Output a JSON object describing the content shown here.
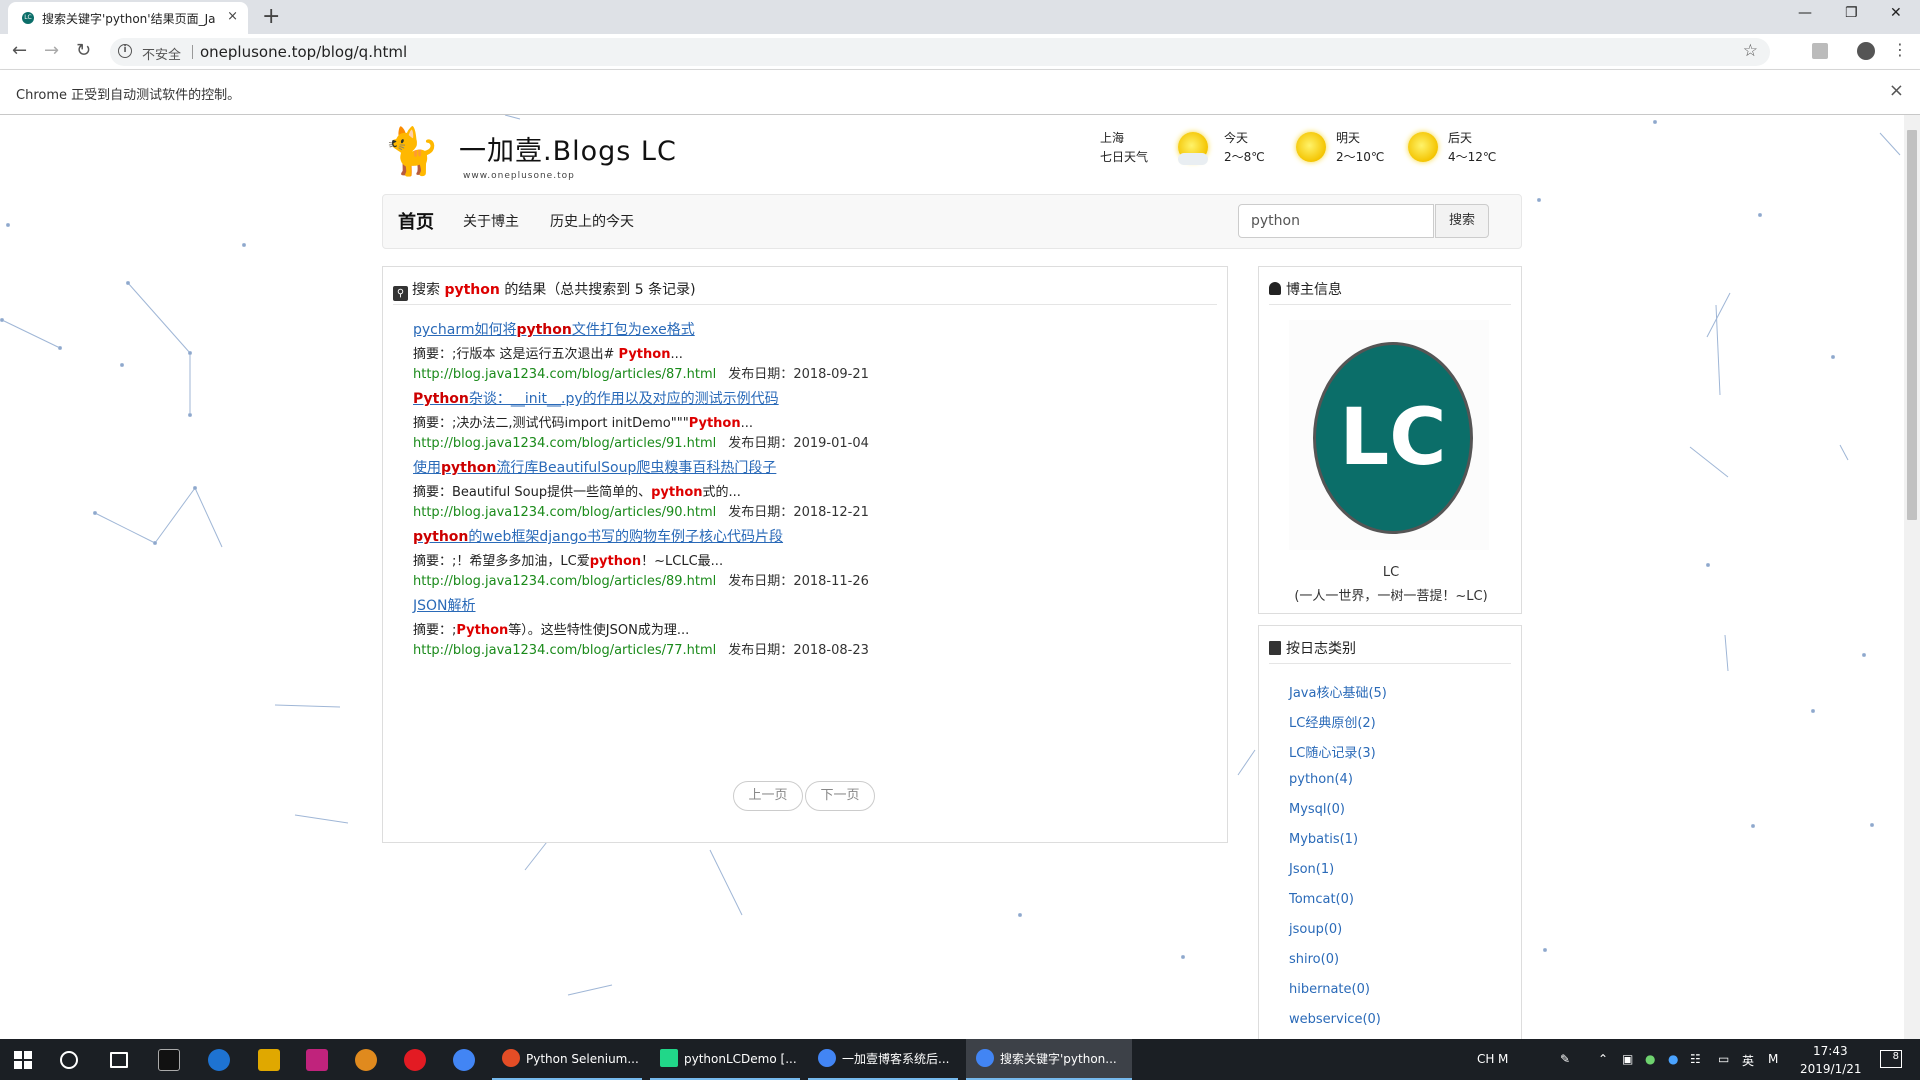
{
  "browser": {
    "tab_title": "搜索关键字'python'结果页面_Ja",
    "tab_close": "×",
    "new_tab": "+",
    "security_label": "不安全",
    "url": "oneplusone.top/blog/q.html",
    "infobar_message": "Chrome 正受到自动测试软件的控制。",
    "infobar_close": "×",
    "favicon_text": "LC"
  },
  "site": {
    "logo_title": "一加壹.Blogs LC",
    "logo_sub": "www.oneplusone.top",
    "weather": {
      "city": "上海",
      "forecast_label": "七日天气",
      "days": [
        {
          "label": "今天",
          "temp": "2～8℃"
        },
        {
          "label": "明天",
          "temp": "2～10℃"
        },
        {
          "label": "后天",
          "temp": "4～12℃"
        }
      ]
    },
    "nav": {
      "home": "首页",
      "about": "关于博主",
      "history": "历史上的今天"
    },
    "search": {
      "value": "python",
      "button": "搜索"
    }
  },
  "results": {
    "head_prefix": "搜索",
    "keyword": "python",
    "head_suffix": "的结果（总共搜索到 5 条记录)",
    "date_label": "发布日期：",
    "items": [
      {
        "title_pre": "pycharm如何将",
        "title_hl": "python",
        "title_post": "文件打包为exe格式",
        "summary_pre": "摘要：;行版本 这是运行五次退出# ",
        "summary_hl": "Python",
        "summary_post": "...",
        "url": "http://blog.java1234.com/blog/articles/87.html",
        "date": "2018-09-21"
      },
      {
        "title_pre": "",
        "title_hl": "Python",
        "title_post": "杂谈：__init__.py的作用以及对应的测试示例代码",
        "summary_pre": "摘要：;决办法二,测试代码import initDemo\"\"\"",
        "summary_hl": "Python",
        "summary_post": "...",
        "url": "http://blog.java1234.com/blog/articles/91.html",
        "date": "2019-01-04"
      },
      {
        "title_pre": "使用",
        "title_hl": "python",
        "title_post": "流行库BeautifulSoup爬虫糗事百科热门段子",
        "summary_pre": "摘要：Beautiful Soup提供一些简单的、",
        "summary_hl": "python",
        "summary_post": "式的...",
        "url": "http://blog.java1234.com/blog/articles/90.html",
        "date": "2018-12-21"
      },
      {
        "title_pre": "",
        "title_hl": "python",
        "title_post": "的web框架django书写的购物车例子核心代码片段",
        "summary_pre": "摘要：;！希望多多加油，LC爱",
        "summary_hl": "python",
        "summary_post": "！~LCLC最...",
        "url": "http://blog.java1234.com/blog/articles/89.html",
        "date": "2018-11-26"
      },
      {
        "title_pre": "JSON解析",
        "title_hl": "",
        "title_post": "",
        "summary_pre": "摘要：;",
        "summary_hl": "Python",
        "summary_post": "等）。这些特性使JSON成为理...",
        "url": "http://blog.java1234.com/blog/articles/77.html",
        "date": "2018-08-23"
      }
    ],
    "pager": {
      "prev": "上一页",
      "next": "下一页"
    }
  },
  "sidebar": {
    "blogger_heading": "博主信息",
    "avatar_text": "LC",
    "blogger_name": "LC",
    "blogger_motto": "(一人一世界，一树一菩提！~LC)",
    "category_heading": "按日志类别",
    "categories": [
      "Java核心基础(5)",
      "LC经典原创(2)",
      "LC随心记录(3)",
      "python(4)",
      "Mysql(0)",
      "Mybatis(1)",
      "Json(1)",
      "Tomcat(0)",
      "jsoup(0)",
      "shiro(0)",
      "hibernate(0)",
      "webservice(0)"
    ]
  },
  "taskbar": {
    "apps": [
      {
        "label": "Python Selenium...",
        "color": "#e44d26"
      },
      {
        "label": "pythonLCDemo [...",
        "color": "#21d789"
      },
      {
        "label": "一加壹博客系统后...",
        "color": "#4285f4"
      },
      {
        "label": "搜索关键字'python...",
        "color": "#4285f4"
      }
    ],
    "tray_lang": "CH",
    "tray_ime": "英",
    "tray_m": "M",
    "time": "17:43",
    "date": "2019/1/21",
    "notifications": "8"
  }
}
